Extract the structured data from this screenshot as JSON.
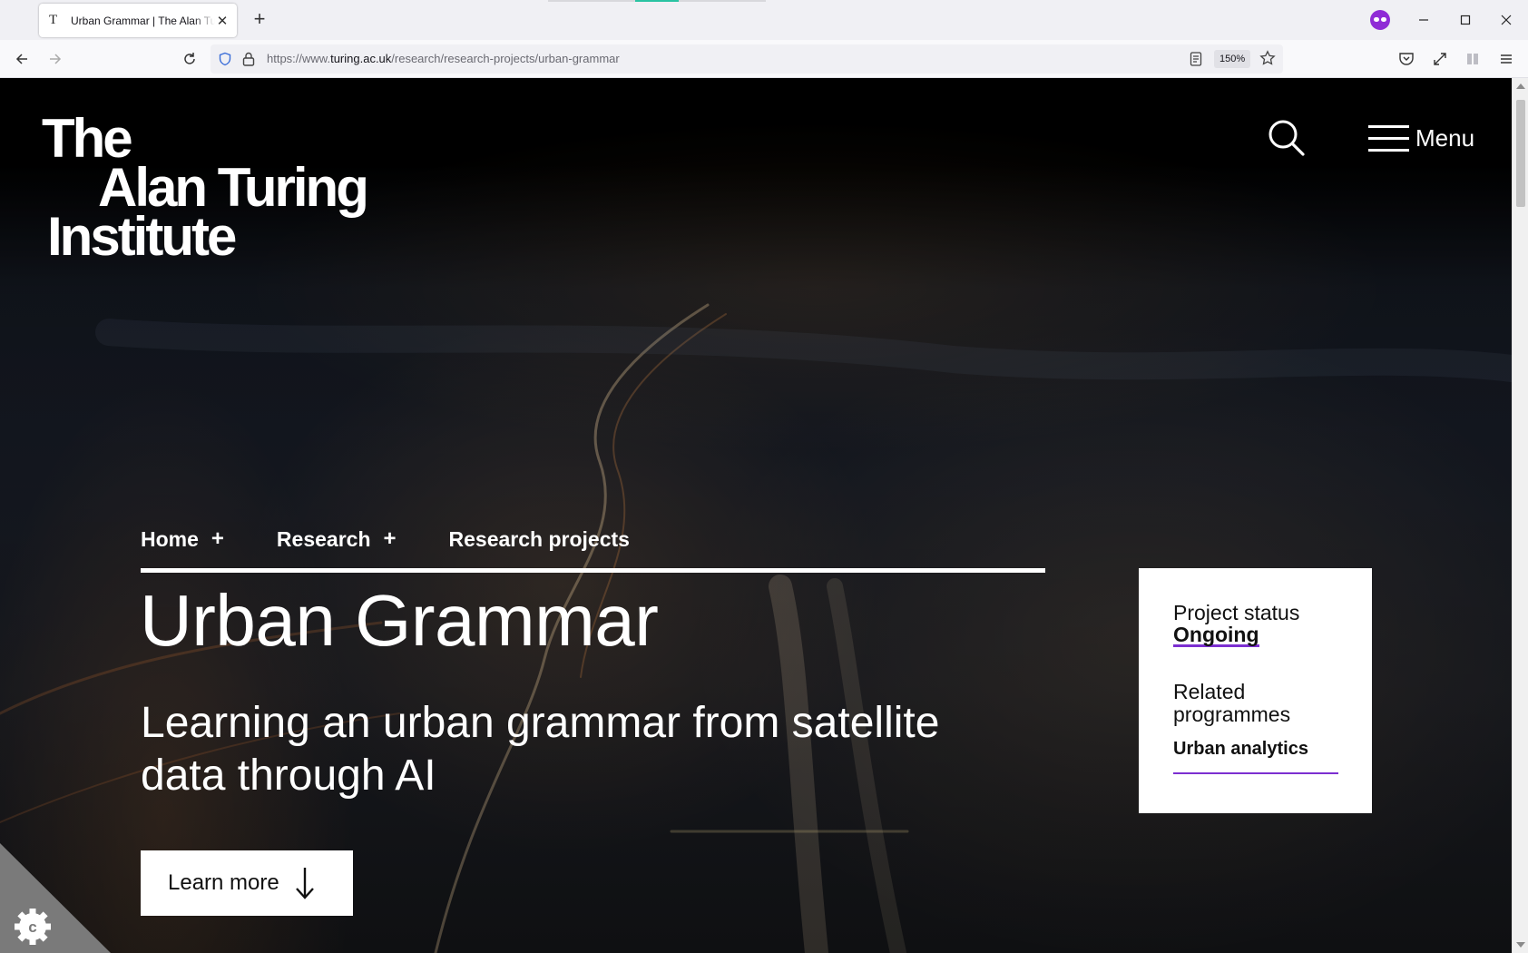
{
  "browser": {
    "tab_favicon": "T",
    "tab_title": "Urban Grammar | The Alan Turing Institute",
    "url_prefix": "https://www.",
    "url_domain": "turing.ac.uk",
    "url_path": "/research/research-projects/urban-grammar",
    "zoom": "150%"
  },
  "icons": {
    "back": "back-arrow-icon",
    "forward": "forward-arrow-icon",
    "reload": "reload-icon",
    "shield": "tracking-protection-shield-icon",
    "lock": "lock-icon",
    "reader": "reader-view-icon",
    "bookmark": "star-icon",
    "pocket": "pocket-icon",
    "fullscreen": "expand-icon",
    "library": "library-icon",
    "menu": "hamburger-icon",
    "private": "private-browsing-icon",
    "search": "search-icon",
    "cookie": "cookie-settings-gear-icon"
  },
  "site": {
    "logo_line1": "The",
    "logo_line2": "Alan Turing",
    "logo_line3": "Institute",
    "menu_label": "Menu"
  },
  "breadcrumb": [
    {
      "label": "Home",
      "expand": "+"
    },
    {
      "label": "Research",
      "expand": "+"
    },
    {
      "label": "Research projects",
      "expand": ""
    }
  ],
  "hero": {
    "title": "Urban Grammar",
    "subtitle": "Learning an urban grammar from satellite data through AI",
    "cta_label": "Learn more"
  },
  "project_card": {
    "status_label": "Project status",
    "status_value": "Ongoing",
    "related_label": "Related programmes",
    "related_programme": "Urban analytics"
  },
  "colors": {
    "accent": "#7c2fd1",
    "private_badge": "#8f2bd6"
  }
}
